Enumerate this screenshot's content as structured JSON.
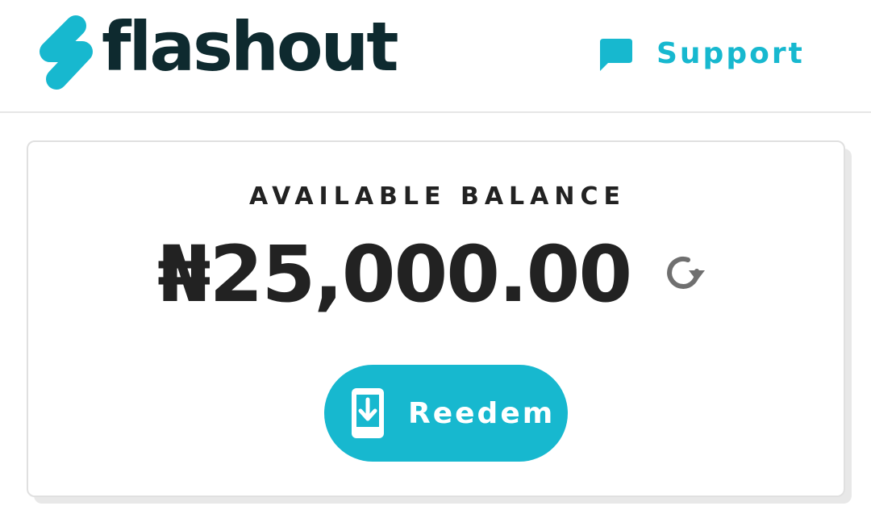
{
  "header": {
    "logo_text": "flashout",
    "logo_icon": "lightning-bolt-icon",
    "support_label": "Support",
    "support_icon": "chat-bubble-icon"
  },
  "balance": {
    "label": "AVAILABLE BALANCE",
    "amount": "₦25,000.00",
    "refresh_icon": "refresh-icon"
  },
  "actions": {
    "redeem_label": "Reedem",
    "redeem_icon": "phone-download-icon"
  },
  "colors": {
    "brand_accent": "#17b8cf",
    "logo_text": "#0e2a2f",
    "body_text": "#222222",
    "background": "#ffffff"
  }
}
